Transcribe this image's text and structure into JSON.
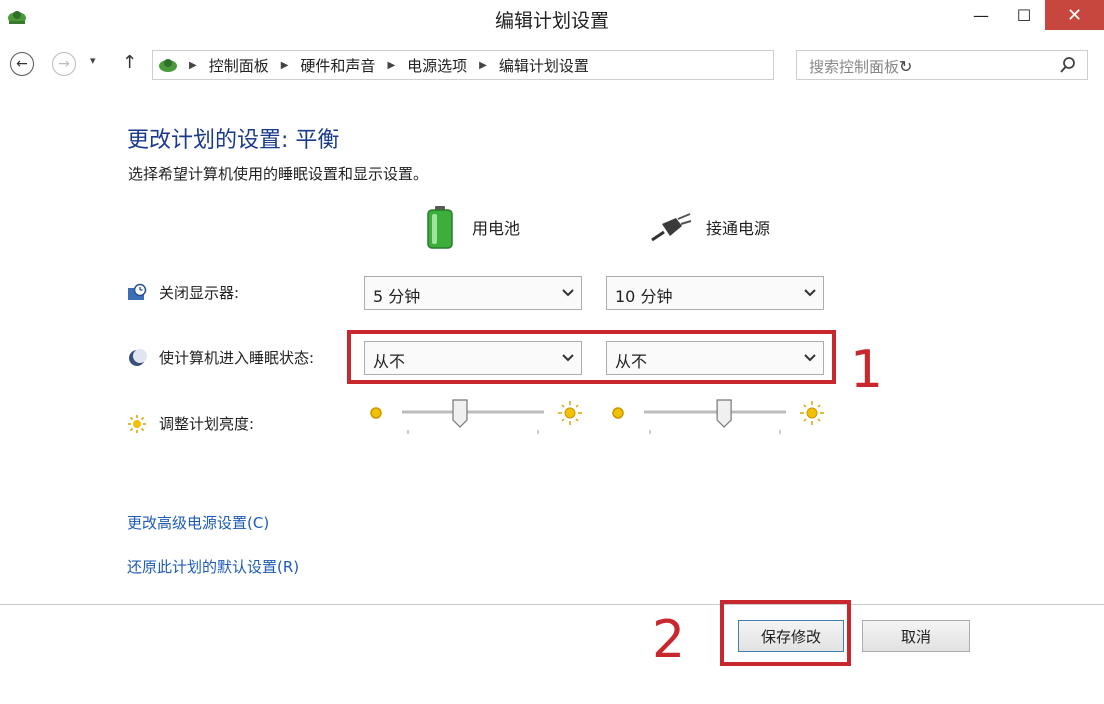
{
  "window": {
    "title": "编辑计划设置",
    "close": "✕",
    "minimize": "—",
    "maximize": "☐"
  },
  "nav": {
    "breadcrumbs": [
      "控制面板",
      "硬件和声音",
      "电源选项",
      "编辑计划设置"
    ],
    "search_placeholder": "搜索控制面板"
  },
  "main": {
    "heading": "更改计划的设置: 平衡",
    "subtitle": "选择希望计算机使用的睡眠设置和显示设置。",
    "columns": {
      "battery": "用电池",
      "plugged": "接通电源"
    },
    "rows": {
      "display": {
        "label": "关闭显示器:",
        "battery": "5 分钟",
        "plugged": "10 分钟"
      },
      "sleep": {
        "label": "使计算机进入睡眠状态:",
        "battery": "从不",
        "plugged": "从不"
      },
      "brightness": {
        "label": "调整计划亮度:",
        "battery_level": 0.4,
        "plugged_level": 0.57
      }
    },
    "links": {
      "advanced": "更改高级电源设置(C)",
      "restore": "还原此计划的默认设置(R)"
    }
  },
  "annotations": {
    "one": "1",
    "two": "2",
    "color": "#c8272d"
  },
  "buttons": {
    "save": "保存修改",
    "cancel": "取消"
  }
}
